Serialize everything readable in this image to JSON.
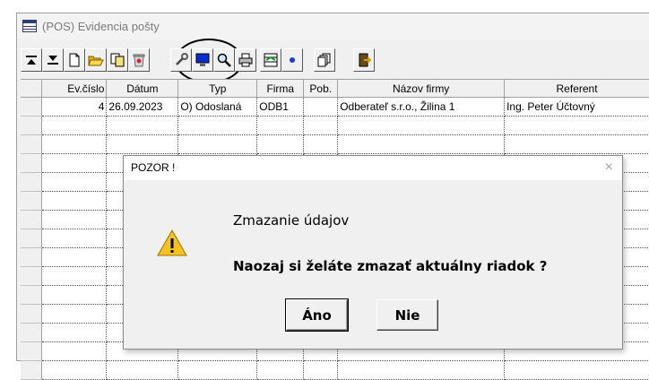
{
  "window": {
    "title": "(POS) Evidencia pošty"
  },
  "toolbar": {
    "buttons": [
      {
        "icon": "move-first-icon"
      },
      {
        "icon": "move-last-icon"
      },
      {
        "icon": "new-document-icon"
      },
      {
        "icon": "open-folder-icon"
      },
      {
        "icon": "copy-icon"
      },
      {
        "icon": "delete-trash-icon"
      },
      {
        "icon": "wrench-icon"
      },
      {
        "icon": "monitor-icon"
      },
      {
        "icon": "search-icon"
      },
      {
        "icon": "print-icon"
      },
      {
        "icon": "grid-arrows-icon"
      },
      {
        "icon": "dot-icon"
      },
      {
        "icon": "copy-pages-icon"
      },
      {
        "icon": "exit-door-icon"
      }
    ]
  },
  "grid": {
    "columns": [
      "Ev.číslo",
      "Dátum",
      "Typ",
      "Firma",
      "Pob.",
      "Názov firmy",
      "Referent"
    ],
    "rows": [
      [
        "4",
        "26.09.2023",
        "O) Odoslaná",
        "ODB1",
        "",
        "Odberateľ s.r.o., Žilina 1",
        "Ing. Peter Účtovný"
      ]
    ]
  },
  "dialog": {
    "title": "POZOR !",
    "close": "×",
    "heading": "Zmazanie údajov",
    "question": "Naozaj si želáte zmazať aktuálny riadok ?",
    "yes_label": "Áno",
    "no_label": "Nie"
  }
}
